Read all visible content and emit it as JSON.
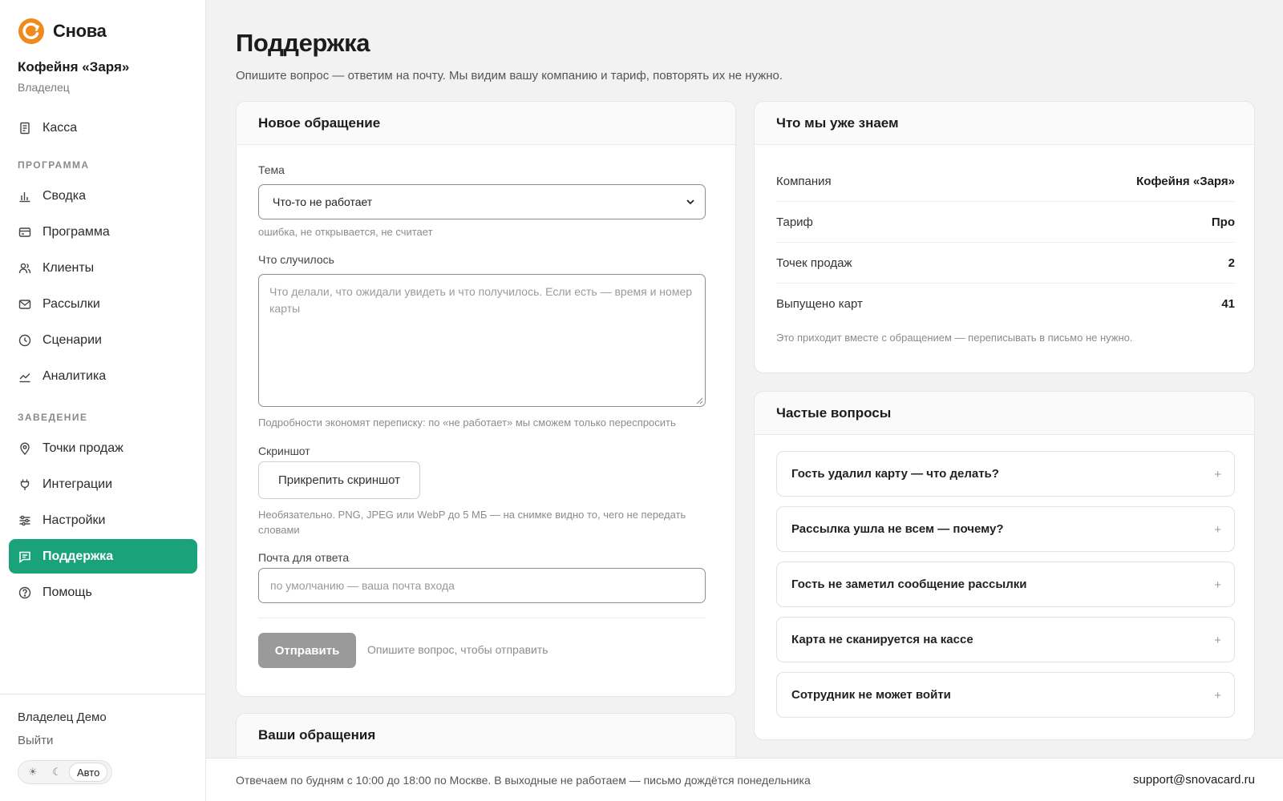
{
  "app": {
    "brand": "Снова",
    "accent": "#1aa37a",
    "logo_color": "#f08a1c"
  },
  "company": {
    "name": "Кофейня «Заря»",
    "role": "Владелец"
  },
  "nav": {
    "kassa": "Касса",
    "section_program": "ПРОГРАММА",
    "svodka": "Сводка",
    "programma": "Программа",
    "klienty": "Клиенты",
    "rassylki": "Рассылки",
    "scenarii": "Сценарии",
    "analitika": "Аналитика",
    "section_venue": "ЗАВЕДЕНИЕ",
    "tochki": "Точки продаж",
    "integracii": "Интеграции",
    "nastroiki": "Настройки",
    "podderzhka": "Поддержка",
    "pomosch": "Помощь"
  },
  "user": {
    "name": "Владелец Демо",
    "logout": "Выйти"
  },
  "theme": {
    "sun": "☀",
    "moon": "☾",
    "auto": "Авто"
  },
  "page": {
    "title": "Поддержка",
    "subtitle": "Опишите вопрос — ответим на почту. Мы видим вашу компанию и тариф, повторять их не нужно."
  },
  "form": {
    "title": "Новое обращение",
    "topic_label": "Тема",
    "topic_value": "Что-то не работает",
    "topic_hint": "ошибка, не открывается, не считает",
    "what_label": "Что случилось",
    "what_placeholder": "Что делали, что ожидали увидеть и что получилось. Если есть — время и номер карты",
    "what_hint": "Подробности экономят переписку: по «не работает» мы сможем только переспросить",
    "screenshot_label": "Скриншот",
    "attach_button": "Прикрепить скриншот",
    "screenshot_hint": "Необязательно. PNG, JPEG или WebP до 5 МБ — на снимке видно то, чего не передать словами",
    "email_label": "Почта для ответа",
    "email_placeholder": "по умолчанию — ваша почта входа",
    "submit": "Отправить",
    "submit_hint": "Опишите вопрос, чтобы отправить"
  },
  "requests": {
    "title": "Ваши обращения"
  },
  "known": {
    "title": "Что мы уже знаем",
    "rows": [
      {
        "k": "Компания",
        "v": "Кофейня «Заря»"
      },
      {
        "k": "Тариф",
        "v": "Про"
      },
      {
        "k": "Точек продаж",
        "v": "2"
      },
      {
        "k": "Выпущено карт",
        "v": "41"
      }
    ],
    "note": "Это приходит вместе с обращением — переписывать в письмо не нужно."
  },
  "faq": {
    "title": "Частые вопросы",
    "items": [
      "Гость удалил карту — что делать?",
      "Рассылка ушла не всем — почему?",
      "Гость не заметил сообщение рассылки",
      "Карта не сканируется на кассе",
      "Сотрудник не может войти"
    ],
    "plus": "+"
  },
  "footer": {
    "hours": "Отвечаем по будням с 10:00 до 18:00 по Москве. В выходные не работаем — письмо дождётся понедельника",
    "email": "support@snovacard.ru"
  }
}
